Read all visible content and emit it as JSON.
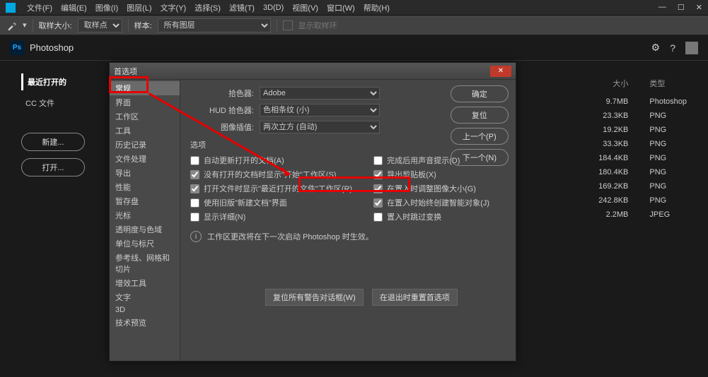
{
  "menubar": {
    "items": [
      "文件(F)",
      "编辑(E)",
      "图像(I)",
      "图层(L)",
      "文字(Y)",
      "选择(S)",
      "滤镜(T)",
      "3D(D)",
      "视图(V)",
      "窗口(W)",
      "帮助(H)"
    ]
  },
  "toolbar": {
    "sampleSizeLabel": "取样大小:",
    "sampleSizeValue": "取样点",
    "sampleLabel": "样本:",
    "sampleValue": "所有图层",
    "hint": "显示取样环"
  },
  "appbar": {
    "name": "Photoshop",
    "ps": "Ps"
  },
  "home": {
    "tabActive": "最近打开的",
    "tabCC": "CC 文件",
    "newBtn": "新建...",
    "openBtn": "打开..."
  },
  "files": {
    "headSize": "大小",
    "headType": "类型",
    "rows": [
      {
        "size": "9.7MB",
        "type": "Photoshop"
      },
      {
        "size": "23.3KB",
        "type": "PNG"
      },
      {
        "size": "19.2KB",
        "type": "PNG"
      },
      {
        "size": "33.3KB",
        "type": "PNG"
      },
      {
        "size": "184.4KB",
        "type": "PNG"
      },
      {
        "size": "180.4KB",
        "type": "PNG"
      },
      {
        "size": "169.2KB",
        "type": "PNG"
      },
      {
        "size": "242.8KB",
        "type": "PNG"
      },
      {
        "size": "2.2MB",
        "type": "JPEG"
      }
    ]
  },
  "dialog": {
    "title": "首选项",
    "categories": [
      "常规",
      "界面",
      "工作区",
      "工具",
      "历史记录",
      "文件处理",
      "导出",
      "性能",
      "暂存盘",
      "光标",
      "透明度与色域",
      "单位与标尺",
      "参考线、网格和切片",
      "增效工具",
      "文字",
      "3D",
      "技术预览"
    ],
    "btnOk": "确定",
    "btnReset": "复位",
    "btnPrev": "上一个(P)",
    "btnNext": "下一个(N)",
    "pickerLabel": "拾色器:",
    "pickerValue": "Adobe",
    "hudLabel": "HUD 拾色器:",
    "hudValue": "色相条纹 (小)",
    "interpLabel": "图像插值:",
    "interpValue": "两次立方 (自动)",
    "optionsLabel": "选项",
    "left": [
      {
        "label": "自动更新打开的文档(A)",
        "checked": false
      },
      {
        "label": "没有打开的文档时显示\"开始\"工作区(S)",
        "checked": true
      },
      {
        "label": "打开文件时显示\"最近打开的文件\"工作区(R)",
        "checked": true
      },
      {
        "label": "使用旧版\"新建文档\"界面",
        "checked": false
      },
      {
        "label": "显示详细(N)",
        "checked": false,
        "dim": true
      }
    ],
    "right": [
      {
        "label": "完成后用声音提示(D)",
        "checked": false
      },
      {
        "label": "导出剪贴板(X)",
        "checked": true
      },
      {
        "label": "在置入时调整图像大小(G)",
        "checked": true
      },
      {
        "label": "在置入时始终创建智能对象(J)",
        "checked": true
      },
      {
        "label": "置入时跳过变换",
        "checked": false
      }
    ],
    "note": "工作区更改将在下一次启动 Photoshop 时生效。",
    "resetWarn": "复位所有警告对话框(W)",
    "resetExit": "在退出时重置首选项"
  }
}
